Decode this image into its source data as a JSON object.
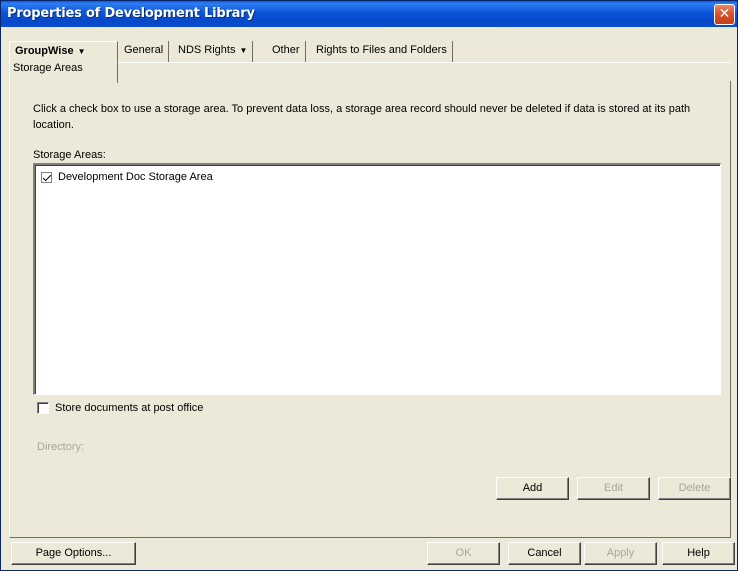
{
  "window": {
    "title": "Properties of Development Library"
  },
  "tabs": [
    {
      "label": "GroupWise",
      "dropdown": true,
      "active": true,
      "subtab": "Storage Areas"
    },
    {
      "label": "General",
      "dropdown": false
    },
    {
      "label": "NDS Rights",
      "dropdown": true
    },
    {
      "label": "Other",
      "dropdown": false
    },
    {
      "label": "Rights to Files and Folders",
      "dropdown": false
    }
  ],
  "panel": {
    "instructions": "Click a check box to use a storage area.  To prevent data loss, a storage area record should never be deleted if data is stored at its path location.",
    "storage_areas_label": "Storage Areas:",
    "storage_areas": [
      {
        "label": "Development Doc Storage Area",
        "checked": true
      }
    ],
    "store_at_post_office": {
      "label": "Store documents at post office",
      "checked": false
    },
    "directory_label": "Directory:",
    "buttons": {
      "add": "Add",
      "edit": "Edit",
      "delete": "Delete"
    }
  },
  "footer": {
    "page_options": "Page Options...",
    "ok": "OK",
    "cancel": "Cancel",
    "apply": "Apply",
    "help": "Help"
  },
  "colors": {
    "titlebar": "#0548c8",
    "dialog_bg": "#ece9d8",
    "close_button": "#d6512d"
  }
}
